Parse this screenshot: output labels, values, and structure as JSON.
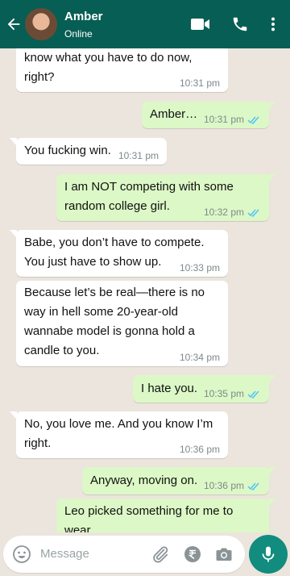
{
  "header": {
    "contact_name": "Amber",
    "contact_status": "Online",
    "color": "#075e54",
    "icons": [
      "arrow-back-icon",
      "video-call-icon",
      "phone-icon",
      "more-vert-icon"
    ]
  },
  "messages": [
    {
      "direction": "in",
      "text": "know what you have to do now, right?",
      "time": "10:31 pm"
    },
    {
      "direction": "out",
      "text": "Amber…",
      "time": "10:31 pm",
      "read": true
    },
    {
      "direction": "in",
      "text": "You fucking win.",
      "time": "10:31 pm"
    },
    {
      "direction": "out",
      "text": " I am NOT competing with some random college girl.",
      "time": "10:32 pm",
      "read": true
    },
    {
      "direction": "in",
      "text": "Babe, you don’t have to compete. You just have to show up.",
      "time": "10:33 pm"
    },
    {
      "direction": "in",
      "text": " Because let’s be real—there is no way in hell some 20-year-old wannabe model is gonna hold a candle to you.",
      "time": "10:34 pm"
    },
    {
      "direction": "out",
      "text": "I hate you.",
      "time": "10:35 pm",
      "read": true
    },
    {
      "direction": "in",
      "text": "No, you love me. And you know I’m right.",
      "time": "10:36 pm"
    },
    {
      "direction": "out",
      "text": "Anyway, moving on.",
      "time": "10:36 pm",
      "read": true
    },
    {
      "direction": "out",
      "text": " Leo picked something for me to wear.",
      "time": "",
      "read": true
    }
  ],
  "input": {
    "placeholder": "Message",
    "icons": [
      "emoji-icon",
      "attach-icon",
      "rupee-payment-icon",
      "camera-icon",
      "mic-icon"
    ]
  },
  "colors": {
    "incoming_bubble": "#ffffff",
    "outgoing_bubble": "#dcf8c6",
    "read_ticks": "#4fc3f7",
    "chat_background": "#ece5dd",
    "mic_button": "#128c7e"
  }
}
